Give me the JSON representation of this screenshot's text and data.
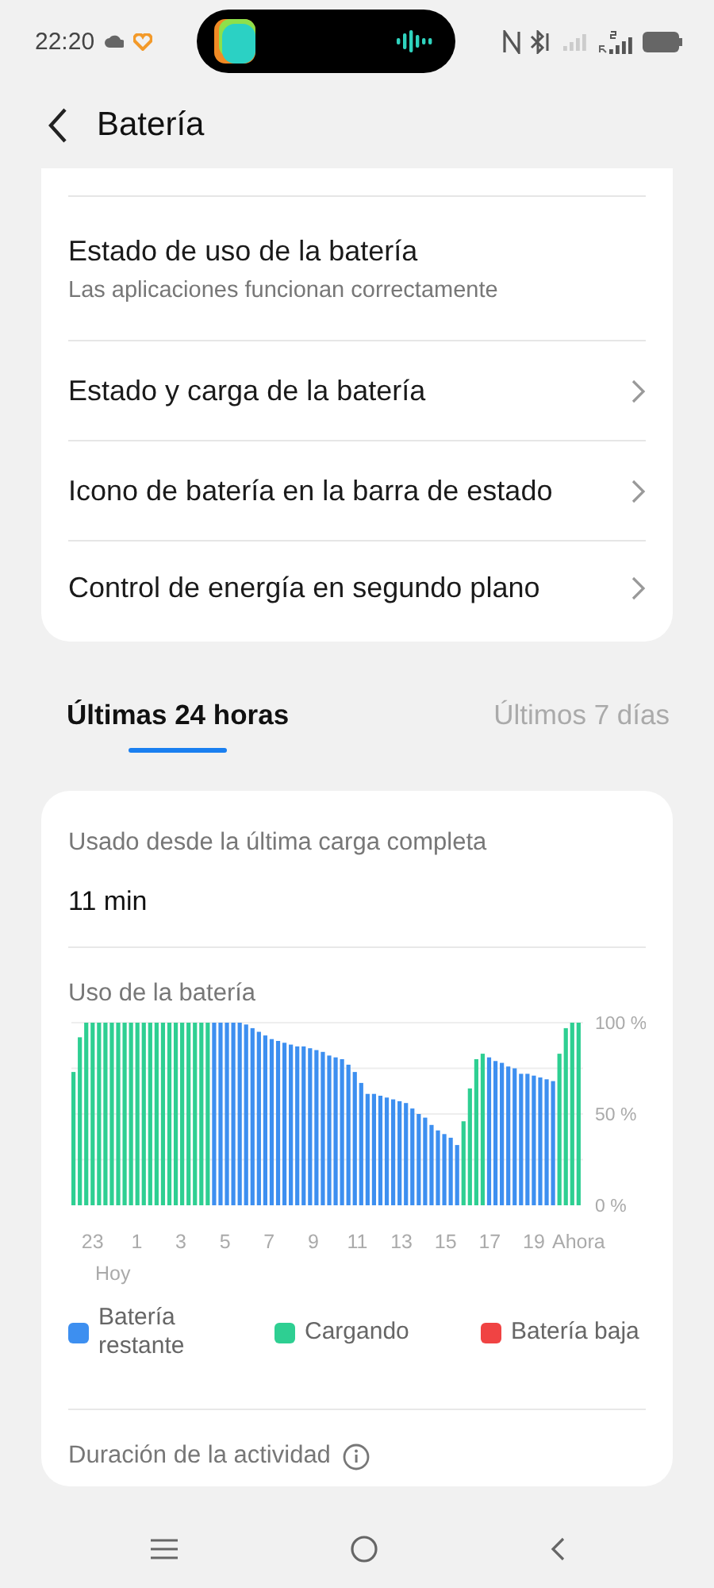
{
  "status_bar": {
    "time": "22:20"
  },
  "header": {
    "title": "Batería"
  },
  "settings": [
    {
      "kind": "info",
      "title": "Estado de uso de la batería",
      "subtitle": "Las aplicaciones funcionan correctamente"
    },
    {
      "kind": "link",
      "title": "Estado y carga de la batería"
    },
    {
      "kind": "link",
      "title": "Icono de batería en la barra de estado"
    },
    {
      "kind": "link",
      "title": "Control de energía en segundo plano"
    }
  ],
  "tabs": [
    {
      "label": "Últimas 24 horas",
      "selected": true
    },
    {
      "label": "Últimos 7 días",
      "selected": false
    }
  ],
  "usage_card": {
    "since_label": "Usado desde la última carga completa",
    "since_value": "11 min",
    "chart_title": "Uso de la batería",
    "chart_data": {
      "type": "bar",
      "ylim": [
        0,
        100
      ],
      "yticks": [
        {
          "value": 0,
          "label": "0 %"
        },
        {
          "value": 50,
          "label": "50 %"
        },
        {
          "value": 100,
          "label": "100 %"
        }
      ],
      "series": [
        {
          "name": "Batería restante",
          "color": "#3d8ff0",
          "values": [
            null,
            null,
            null,
            null,
            null,
            null,
            null,
            null,
            null,
            null,
            null,
            null,
            null,
            null,
            null,
            null,
            null,
            null,
            null,
            null,
            null,
            null,
            100,
            100,
            100,
            100,
            100,
            99,
            97,
            95,
            93,
            91,
            90,
            89,
            88,
            87,
            87,
            86,
            85,
            84,
            82,
            81,
            80,
            77,
            73,
            67,
            61,
            61,
            60,
            59,
            58,
            57,
            56,
            53,
            50,
            48,
            44,
            41,
            39,
            37,
            33,
            null,
            null,
            null,
            null,
            81,
            79,
            78,
            76,
            75,
            72,
            72,
            71,
            70,
            69,
            68,
            null,
            null,
            null,
            null
          ]
        },
        {
          "name": "Cargando",
          "color": "#2ecf92",
          "values": [
            73,
            92,
            100,
            100,
            100,
            100,
            100,
            100,
            100,
            100,
            100,
            100,
            100,
            100,
            100,
            100,
            100,
            100,
            100,
            100,
            100,
            100,
            null,
            null,
            null,
            null,
            null,
            null,
            null,
            null,
            null,
            null,
            null,
            null,
            null,
            null,
            null,
            null,
            null,
            null,
            null,
            null,
            null,
            null,
            null,
            null,
            null,
            null,
            null,
            null,
            null,
            null,
            null,
            null,
            null,
            null,
            null,
            null,
            null,
            null,
            null,
            46,
            64,
            80,
            83,
            null,
            null,
            null,
            null,
            null,
            null,
            null,
            null,
            null,
            null,
            null,
            83,
            97,
            100,
            100
          ]
        },
        {
          "name": "Batería baja",
          "color": "#f04343",
          "values": [
            null,
            null,
            null,
            null,
            null,
            null,
            null,
            null,
            null,
            null,
            null,
            null,
            null,
            null,
            null,
            null,
            null,
            null,
            null,
            null,
            null,
            null,
            null,
            null,
            null,
            null,
            null,
            null,
            null,
            null,
            null,
            null,
            null,
            null,
            null,
            null,
            null,
            null,
            null,
            null,
            null,
            null,
            null,
            null,
            null,
            null,
            null,
            null,
            null,
            null,
            null,
            null,
            null,
            null,
            null,
            null,
            null,
            null,
            null,
            null,
            null,
            null,
            null,
            null,
            null,
            null,
            null,
            null,
            null,
            null,
            null,
            null,
            null,
            null,
            null,
            null,
            null,
            null,
            null,
            null
          ]
        }
      ]
    },
    "x_labels": [
      "23",
      "1",
      "3",
      "5",
      "7",
      "9",
      "11",
      "13",
      "15",
      "17",
      "19",
      "Ahora"
    ],
    "x_sublabel": "Hoy",
    "activity_title": "Duración de la actividad"
  }
}
